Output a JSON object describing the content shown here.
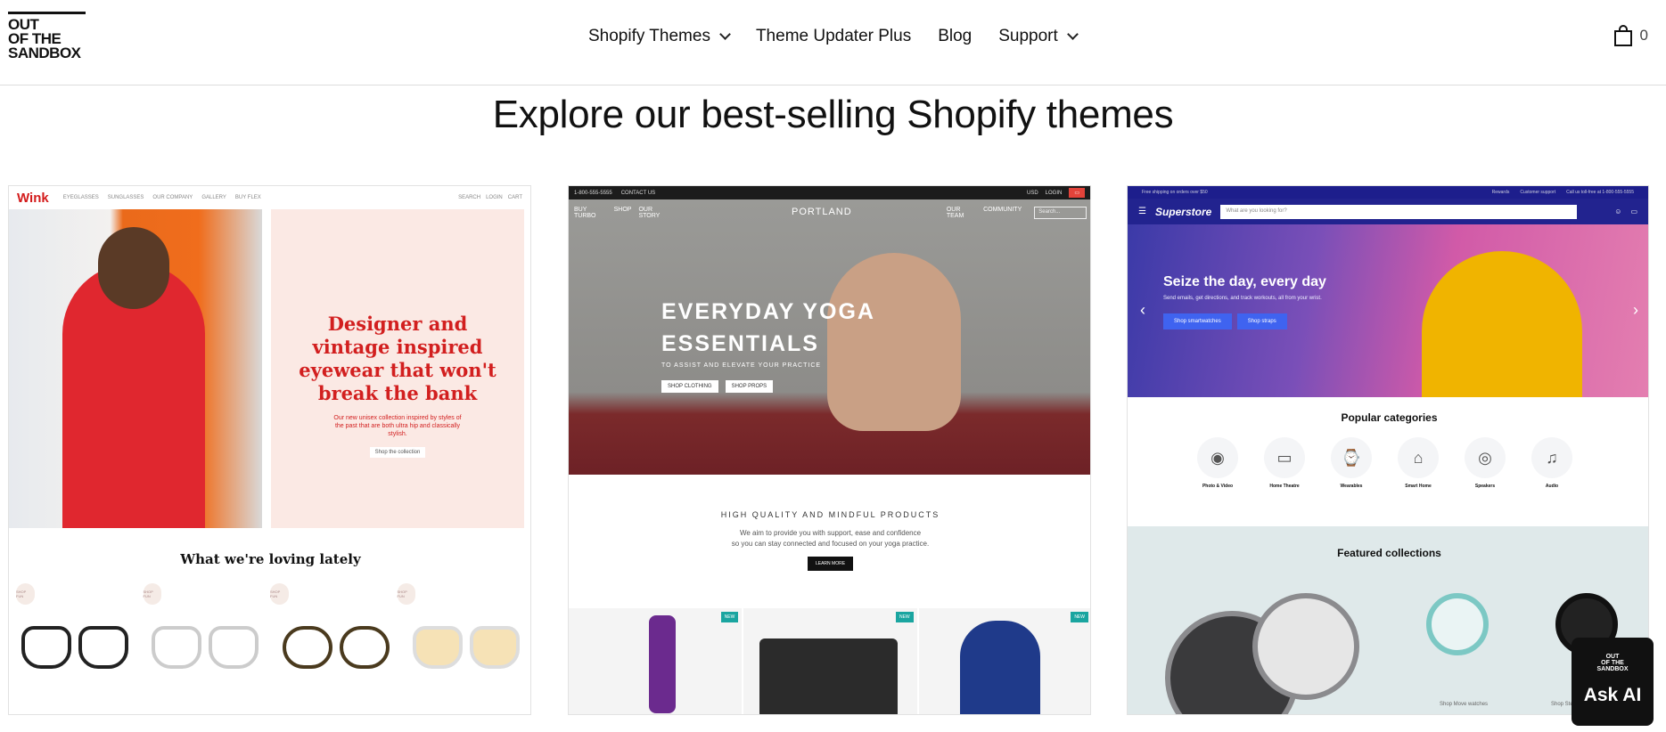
{
  "header": {
    "logo_lines": [
      "OUT",
      "OF THE",
      "SANDBOX"
    ],
    "nav": [
      {
        "label": "Shopify Themes",
        "dropdown": true
      },
      {
        "label": "Theme Updater Plus",
        "dropdown": false
      },
      {
        "label": "Blog",
        "dropdown": false
      },
      {
        "label": "Support",
        "dropdown": true
      }
    ],
    "cart_count": "0"
  },
  "main": {
    "heading": "Explore our best-selling Shopify themes"
  },
  "cards": {
    "wink": {
      "logo": "Wink",
      "nav": [
        "EYEGLASSES",
        "SUNGLASSES",
        "OUR COMPANY",
        "GALLERY",
        "BUY FLEX"
      ],
      "nav_right": [
        "SEARCH",
        "LOGIN",
        "CART"
      ],
      "headline": "Designer and vintage inspired eyewear that won't break the bank",
      "subtext": "Our new unisex collection inspired by styles of the past that are both ultra hip and classically stylish.",
      "button": "Shop the collection",
      "section_title": "What we're loving lately",
      "badge": "SHOP FUN"
    },
    "portland": {
      "top_left": [
        "1-800-555-5555",
        "CONTACT US"
      ],
      "top_right": [
        "USD",
        "LOGIN"
      ],
      "nav_left": [
        "BUY TURBO",
        "SHOP",
        "OUR STORY"
      ],
      "logo": "PORTLAND",
      "nav_right": [
        "OUR TEAM",
        "COMMUNITY"
      ],
      "search_placeholder": "Search...",
      "hero_title_1": "EVERYDAY YOGA",
      "hero_title_2": "ESSENTIALS",
      "hero_sub": "TO ASSIST AND ELEVATE YOUR PRACTICE",
      "btn_1": "SHOP CLOTHING",
      "btn_2": "SHOP PROPS",
      "mid_title": "HIGH QUALITY AND MINDFUL PRODUCTS",
      "mid_desc_1": "We aim to provide you with support, ease and confidence",
      "mid_desc_2": "so you can stay connected and focused on your yoga practice.",
      "mid_btn": "LEARN MORE",
      "new_badge": "NEW"
    },
    "superstore": {
      "top_left": "Free shipping on orders over $50",
      "top_right": [
        "Rewards",
        "Customer support",
        "Call us toll-free at 1-800-555-5555"
      ],
      "logo": "Superstore",
      "search_placeholder": "What are you looking for?",
      "hero_title": "Seize the day, every day",
      "hero_desc": "Send emails, get directions, and track workouts, all from your wrist.",
      "btn_1": "Shop smartwatches",
      "btn_2": "Shop straps",
      "categories_title": "Popular categories",
      "categories": [
        {
          "label": "Photo & Video",
          "icon": "camera-icon"
        },
        {
          "label": "Home Theatre",
          "icon": "tv-icon"
        },
        {
          "label": "Wearables",
          "icon": "watch-icon"
        },
        {
          "label": "Smart Home",
          "icon": "home-icon"
        },
        {
          "label": "Speakers",
          "icon": "speaker-icon"
        },
        {
          "label": "Audio",
          "icon": "headphones-icon"
        }
      ],
      "featured_title": "Featured collections",
      "featured_labels": [
        "Shop Move watches",
        "Shop Ste"
      ]
    }
  },
  "ask_ai": {
    "logo_lines": [
      "OUT",
      "OF THE",
      "SANDBOX"
    ],
    "label": "Ask AI"
  }
}
